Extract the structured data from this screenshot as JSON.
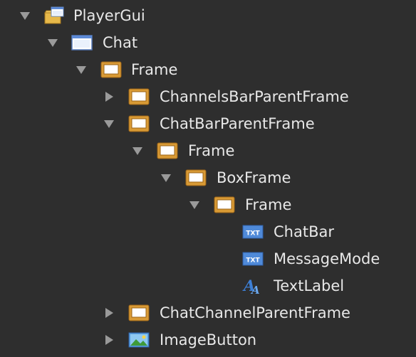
{
  "explorer": {
    "nodes": [
      {
        "label": "PlayerGui",
        "icon": "player-gui-icon",
        "expanded": true
      },
      {
        "label": "Chat",
        "icon": "screen-gui-icon",
        "expanded": true
      },
      {
        "label": "Frame",
        "icon": "frame-icon",
        "expanded": true
      },
      {
        "label": "ChannelsBarParentFrame",
        "icon": "frame-icon",
        "expanded": false
      },
      {
        "label": "ChatBarParentFrame",
        "icon": "frame-icon",
        "expanded": true
      },
      {
        "label": "Frame",
        "icon": "frame-icon",
        "expanded": true
      },
      {
        "label": "BoxFrame",
        "icon": "frame-icon",
        "expanded": true
      },
      {
        "label": "Frame",
        "icon": "frame-icon",
        "expanded": true
      },
      {
        "label": "ChatBar",
        "icon": "textbox-icon"
      },
      {
        "label": "MessageMode",
        "icon": "textbox-icon"
      },
      {
        "label": "TextLabel",
        "icon": "textlabel-icon"
      },
      {
        "label": "ChatChannelParentFrame",
        "icon": "frame-icon",
        "expanded": false
      },
      {
        "label": "ImageButton",
        "icon": "image-button-icon",
        "expanded": false
      }
    ]
  },
  "colors": {
    "background": "#2e2e2e",
    "text": "#e8e8e8",
    "arrow": "#9a9a9a",
    "frame_border": "#c8892a"
  },
  "icon_glyphs": {
    "textbox": "TXT",
    "textlabel": "A"
  }
}
